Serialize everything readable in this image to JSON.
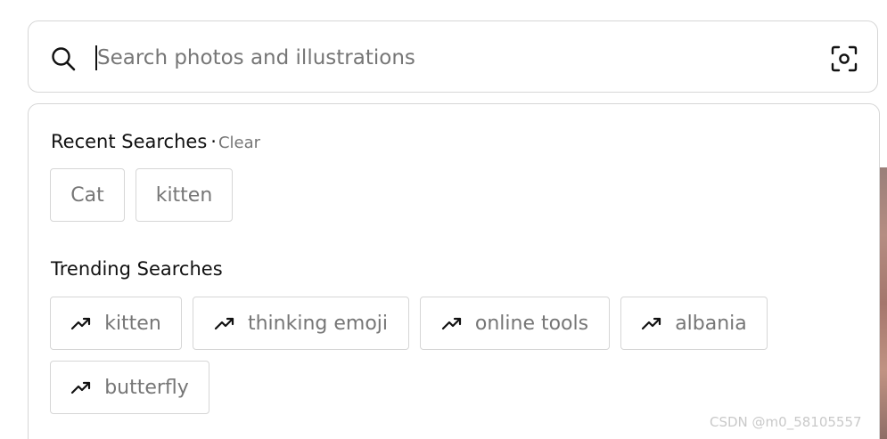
{
  "search": {
    "placeholder": "Search photos and illustrations",
    "value": ""
  },
  "icons": {
    "search": "search-icon",
    "visual_search": "visual-search-icon",
    "trending": "trending-up-icon"
  },
  "recent": {
    "title": "Recent Searches",
    "separator": "·",
    "clear_label": "Clear",
    "items": [
      "Cat",
      "kitten"
    ]
  },
  "trending": {
    "title": "Trending Searches",
    "items": [
      "kitten",
      "thinking emoji",
      "online tools",
      "albania",
      "butterfly"
    ]
  },
  "watermark": "CSDN @m0_58105557",
  "colors": {
    "border": "#d6d6d6",
    "muted_text": "#767676",
    "primary_text": "#111111"
  }
}
